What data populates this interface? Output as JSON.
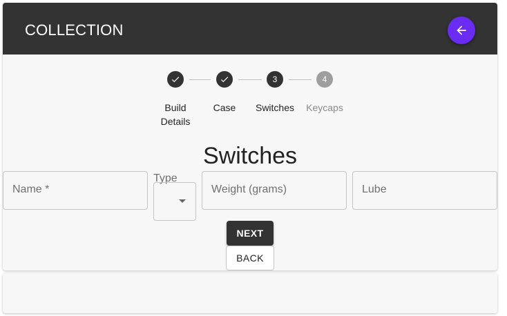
{
  "appbar": {
    "title": "COLLECTION"
  },
  "stepper": {
    "steps": [
      {
        "label": "Build Details",
        "status": "completed"
      },
      {
        "label": "Case",
        "status": "completed"
      },
      {
        "number": "3",
        "label": "Switches",
        "status": "active"
      },
      {
        "number": "4",
        "label": "Keycaps",
        "status": "pending"
      }
    ]
  },
  "section": {
    "title": "Switches"
  },
  "form": {
    "name_placeholder": "Name *",
    "type_label": "Type",
    "type_value": "",
    "weight_placeholder": "Weight (grams)",
    "lube_placeholder": "Lube"
  },
  "actions": {
    "next_label": "NEXT",
    "back_label": "BACK"
  },
  "colors": {
    "appbar": "#333333",
    "fab": "#6a2cf0",
    "background": "#f7f7f7"
  }
}
